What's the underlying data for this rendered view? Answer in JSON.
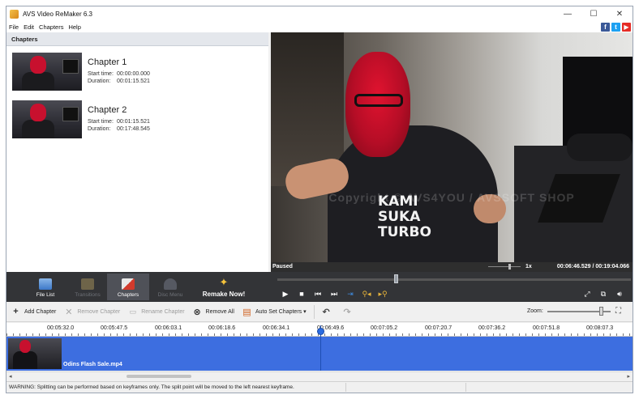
{
  "window": {
    "title": "AVS Video ReMaker 6.3"
  },
  "menu": [
    "File",
    "Edit",
    "Chapters",
    "Help"
  ],
  "social": {
    "facebook": "f",
    "twitter": "t",
    "youtube": "▶"
  },
  "chapters_panel": {
    "header": "Chapters",
    "start_label": "Start time:",
    "duration_label": "Duration:",
    "items": [
      {
        "title": "Chapter 1",
        "start": "00:00:00.000",
        "duration": "00:01:15.521"
      },
      {
        "title": "Chapter 2",
        "start": "00:01:15.521",
        "duration": "00:17:48.545"
      }
    ]
  },
  "preview": {
    "watermark": "Copyright © AVS4YOU / AVSSOFT SHOP",
    "shirt_text": [
      "KAMI",
      "SUKA",
      "TURBO"
    ],
    "status": "Paused",
    "speed": "1x",
    "time": "00:06:46.529 / 00:19:04.066",
    "seek_position": 0.335
  },
  "modes": [
    {
      "label": "File List",
      "state": "normal"
    },
    {
      "label": "Transitions",
      "state": "disabled"
    },
    {
      "label": "Chapters",
      "state": "active"
    },
    {
      "label": "Disc Menu",
      "state": "disabled"
    }
  ],
  "remake_label": "Remake Now!",
  "toolbar": {
    "add_chapter": "Add Chapter",
    "remove_chapter": "Remove Chapter",
    "rename_chapter": "Rename Chapter",
    "remove_all": "Remove All",
    "auto_set": "Auto Set Chapters",
    "zoom_label": "Zoom:"
  },
  "ruler": [
    "00:05:32.0",
    "00:05:47.5",
    "00:06:03.1",
    "00:06:18.6",
    "00:06:34.1",
    "00:06:49.6",
    "00:07:05.2",
    "00:07:20.7",
    "00:07:36.2",
    "00:07:51.8",
    "00:08:07.3"
  ],
  "clip": {
    "name": "Odins Flash Sale.mp4"
  },
  "status_message": "WARNING: Splitting can be performed based on keyframes only. The split point will be moved to the left nearest keyframe.",
  "colors": {
    "accent": "#3d6ee0",
    "controls_bg": "#333437",
    "thumb_red": "#c8102e"
  }
}
